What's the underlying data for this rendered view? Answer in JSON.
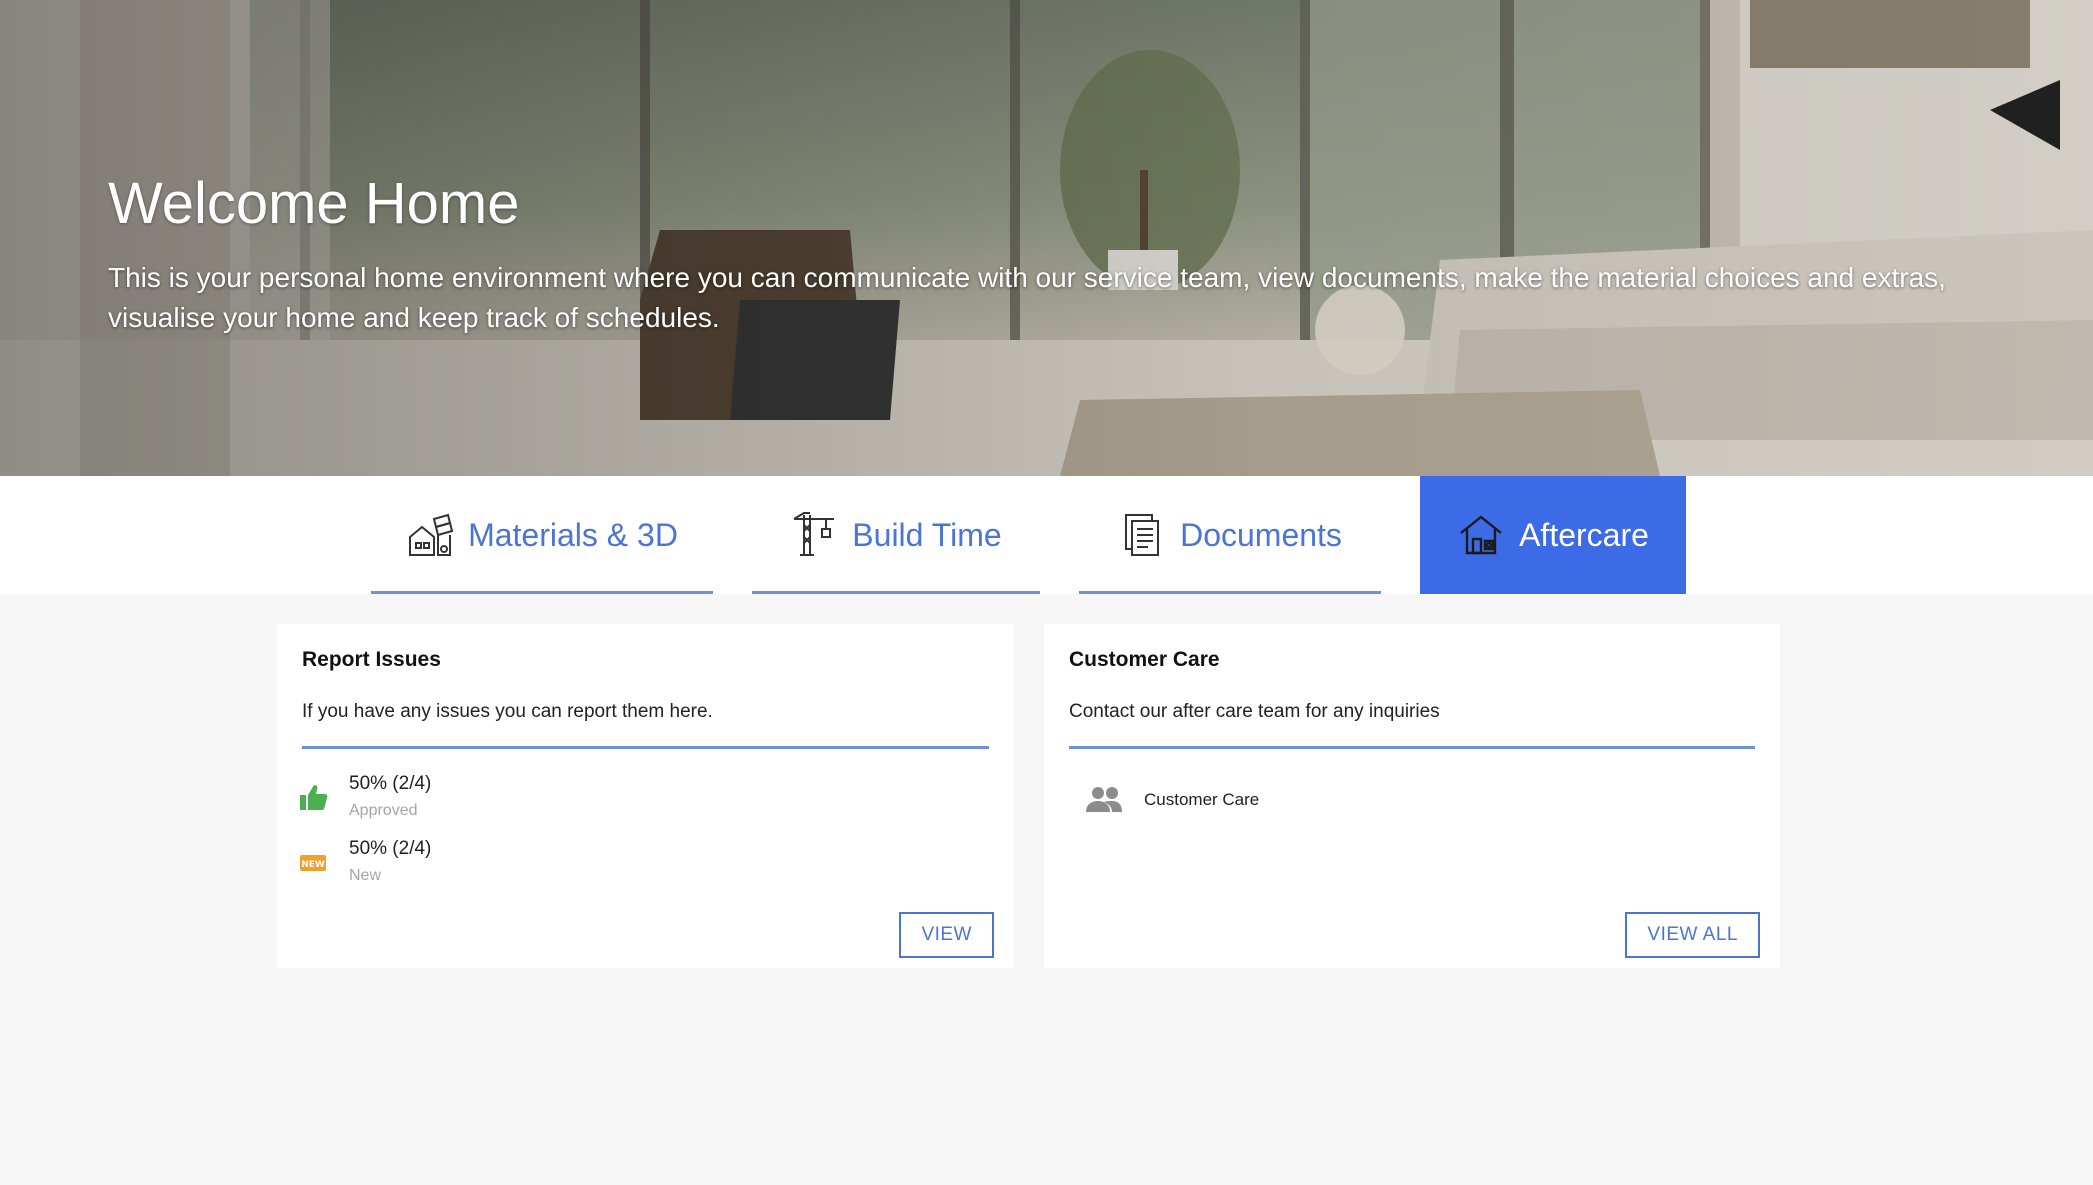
{
  "hero": {
    "title": "Welcome Home",
    "subtitle": "This is your personal home environment where you can communicate with our service team, view documents, make the material choices and extras, visualise your home and keep track of schedules."
  },
  "tabs": [
    {
      "label": "Materials & 3D",
      "icon": "swatches-house-icon",
      "active": false
    },
    {
      "label": "Build Time",
      "icon": "crane-icon",
      "active": false
    },
    {
      "label": "Documents",
      "icon": "documents-icon",
      "active": false
    },
    {
      "label": "Aftercare",
      "icon": "house-repair-icon",
      "active": true
    }
  ],
  "report_issues": {
    "title": "Report Issues",
    "description": "If you have any issues you can report them here.",
    "stats": [
      {
        "value": "50% (2/4)",
        "label": "Approved",
        "icon": "thumbs-up-icon",
        "color": "#4caf50"
      },
      {
        "value": "50% (2/4)",
        "label": "New",
        "icon": "new-badge-icon",
        "color": "#f0a030"
      }
    ],
    "button_label": "VIEW"
  },
  "customer_care": {
    "title": "Customer Care",
    "description": "Contact our after care team for any inquiries",
    "contact_name": "Customer Care",
    "contact_icon": "people-icon",
    "button_label": "VIEW ALL"
  },
  "colors": {
    "accent": "#3d6ae6",
    "link": "#4a74d6",
    "rule": "#6e8fd9",
    "background": "#f7f7f7"
  }
}
